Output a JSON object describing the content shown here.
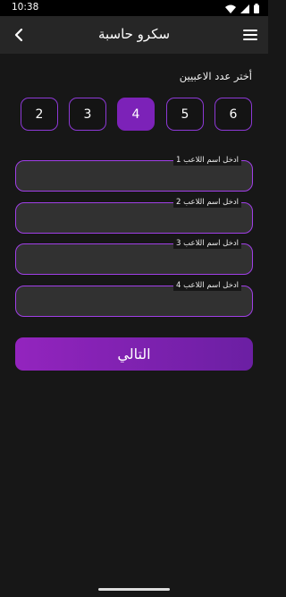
{
  "status_bar": {
    "time": "10:38",
    "icons": [
      "settings-icon",
      "wifi-icon",
      "signal-icon",
      "battery-icon"
    ]
  },
  "app_bar": {
    "title": "سكرو حاسبة",
    "back_icon": "chevron-left-icon",
    "menu_icon": "hamburger-menu-icon"
  },
  "player_count": {
    "label": "أختر عدد الاعبيين",
    "options": [
      "2",
      "3",
      "4",
      "5",
      "6"
    ],
    "selected": "4"
  },
  "players": [
    {
      "label": "ادخل اسم اللاعب 1",
      "value": ""
    },
    {
      "label": "ادخل اسم اللاعب 2",
      "value": ""
    },
    {
      "label": "ادخل اسم اللاعب 3",
      "value": ""
    },
    {
      "label": "ادخل اسم اللاعب 4",
      "value": ""
    }
  ],
  "next_button": {
    "label": "التالي"
  },
  "colors": {
    "background": "#171717",
    "app_bar": "#262626",
    "accent": "#9324be",
    "accent_dark": "#6b1fa3",
    "field_fill": "#313131",
    "field_border": "#a13fe8"
  }
}
